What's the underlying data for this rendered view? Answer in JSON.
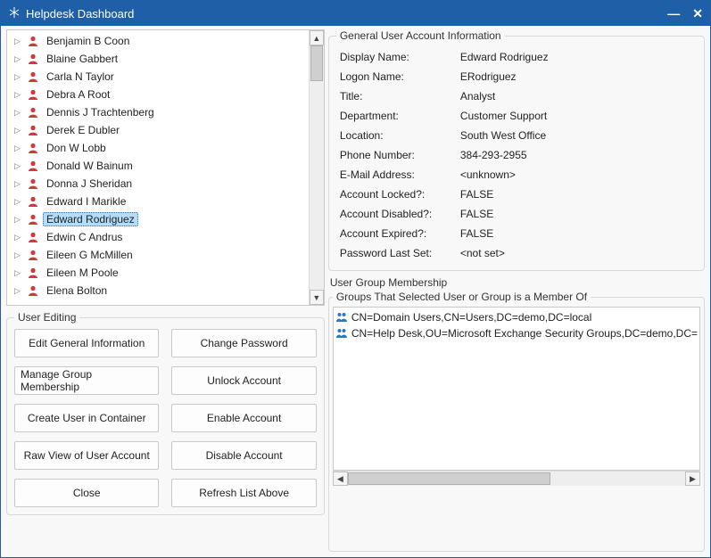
{
  "window": {
    "title": "Helpdesk Dashboard"
  },
  "user_list": {
    "items": [
      {
        "name": "Benjamin B Coon",
        "selected": false
      },
      {
        "name": "Blaine Gabbert",
        "selected": false
      },
      {
        "name": "Carla N Taylor",
        "selected": false
      },
      {
        "name": "Debra A Root",
        "selected": false
      },
      {
        "name": "Dennis J Trachtenberg",
        "selected": false
      },
      {
        "name": "Derek E Dubler",
        "selected": false
      },
      {
        "name": "Don W Lobb",
        "selected": false
      },
      {
        "name": "Donald W Bainum",
        "selected": false
      },
      {
        "name": "Donna J Sheridan",
        "selected": false
      },
      {
        "name": "Edward I Marikle",
        "selected": false
      },
      {
        "name": "Edward Rodriguez",
        "selected": true
      },
      {
        "name": "Edwin C Andrus",
        "selected": false
      },
      {
        "name": "Eileen G McMillen",
        "selected": false
      },
      {
        "name": "Eileen M Poole",
        "selected": false
      },
      {
        "name": "Elena Bolton",
        "selected": false
      }
    ]
  },
  "editing": {
    "legend": "User Editing",
    "buttons": [
      "Edit General Information",
      "Change Password",
      "Manage Group Membership",
      "Unlock Account",
      "Create User in Container",
      "Enable Account",
      "Raw View of User Account",
      "Disable Account",
      "Close",
      "Refresh List Above"
    ]
  },
  "info": {
    "legend": "General User Account Information",
    "rows": [
      {
        "label": "Display Name:",
        "value": "Edward Rodriguez"
      },
      {
        "label": "Logon Name:",
        "value": "ERodriguez"
      },
      {
        "label": "Title:",
        "value": "Analyst"
      },
      {
        "label": "Department:",
        "value": "Customer Support"
      },
      {
        "label": "Location:",
        "value": "South West Office"
      },
      {
        "label": "Phone Number:",
        "value": "384-293-2955"
      },
      {
        "label": "E-Mail Address:",
        "value": "<unknown>"
      },
      {
        "label": "Account Locked?:",
        "value": "FALSE"
      },
      {
        "label": "Account Disabled?:",
        "value": "FALSE"
      },
      {
        "label": "Account Expired?:",
        "value": "FALSE"
      },
      {
        "label": "Password Last Set:",
        "value": "<not set>"
      }
    ]
  },
  "groups": {
    "section_label": "User Group Membership",
    "list_label": "Groups That Selected User or Group is a Member Of",
    "items": [
      {
        "icon": "group-icon",
        "dn": "CN=Domain Users,CN=Users,DC=demo,DC=local"
      },
      {
        "icon": "group-icon",
        "dn": "CN=Help Desk,OU=Microsoft Exchange Security Groups,DC=demo,DC="
      }
    ]
  }
}
